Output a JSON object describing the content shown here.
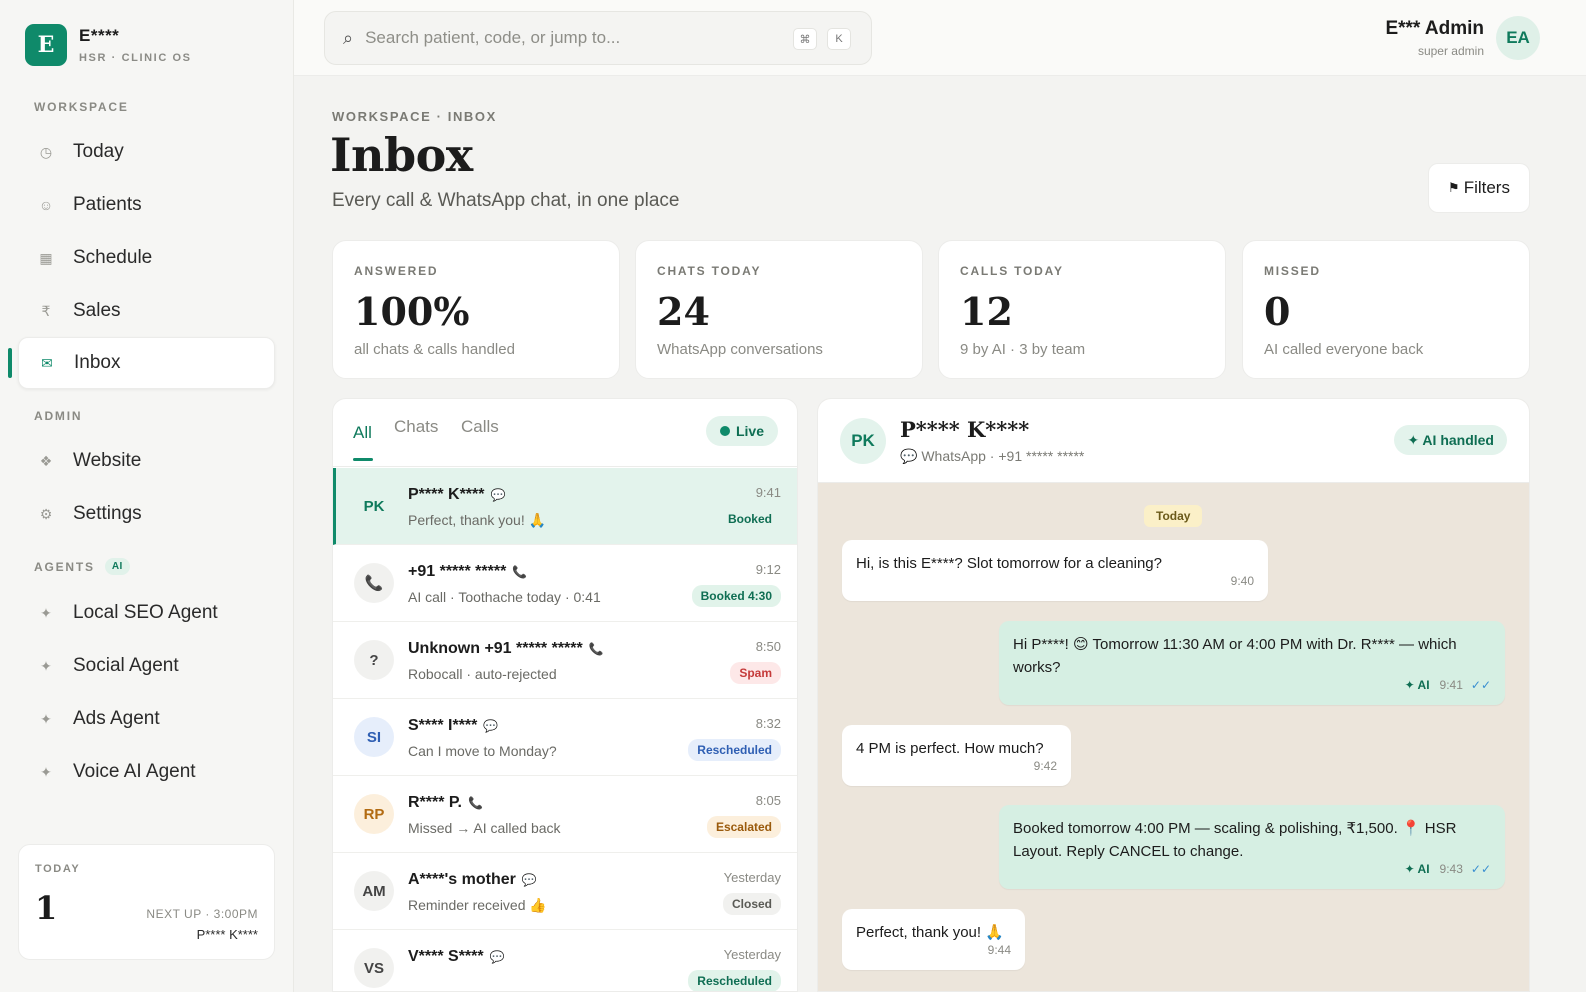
{
  "brand": {
    "logo_letter": "E",
    "name": "E****",
    "sub": "HSR · CLINIC OS"
  },
  "sidebar": {
    "workspace_label": "WORKSPACE",
    "workspace_items": [
      {
        "label": "Today",
        "icon": "clock-icon"
      },
      {
        "label": "Patients",
        "icon": "smile-icon"
      },
      {
        "label": "Schedule",
        "icon": "calendar-icon"
      },
      {
        "label": "Sales",
        "icon": "rupee-icon"
      },
      {
        "label": "Inbox",
        "icon": "mail-icon",
        "active": true
      }
    ],
    "admin_label": "ADMIN",
    "admin_items": [
      {
        "label": "Website",
        "icon": "diamond-icon"
      },
      {
        "label": "Settings",
        "icon": "gear-icon"
      }
    ],
    "agents_label": "AGENTS",
    "agents_chip": "AI",
    "agent_items": [
      {
        "label": "Local SEO Agent",
        "icon": "sparkle-icon"
      },
      {
        "label": "Social Agent",
        "icon": "sparkle-icon"
      },
      {
        "label": "Ads Agent",
        "icon": "sparkle-icon"
      },
      {
        "label": "Voice AI Agent",
        "icon": "sparkle-icon"
      }
    ],
    "today_card": {
      "label": "TODAY",
      "count": "1",
      "next_up": "NEXT UP · 3:00PM",
      "next_name": "P**** K****"
    }
  },
  "search": {
    "placeholder": "Search patient, code, or jump to...",
    "kbd1": "⌘",
    "kbd2": "K"
  },
  "user": {
    "name": "E*** Admin",
    "role": "super admin",
    "initials": "EA"
  },
  "header": {
    "breadcrumb": "WORKSPACE · INBOX",
    "title": "Inbox",
    "subtitle": "Every call & WhatsApp chat, in one place",
    "filters_label": "Filters"
  },
  "stats": [
    {
      "label": "ANSWERED",
      "value": "100%",
      "sub": "all chats & calls handled"
    },
    {
      "label": "CHATS TODAY",
      "value": "24",
      "sub": "WhatsApp conversations"
    },
    {
      "label": "CALLS TODAY",
      "value": "12",
      "sub": "9 by AI · 3 by team"
    },
    {
      "label": "MISSED",
      "value": "0",
      "sub": "AI called everyone back"
    }
  ],
  "list": {
    "tabs": [
      "All",
      "Chats",
      "Calls"
    ],
    "live_label": "Live",
    "rows": [
      {
        "initials": "PK",
        "name": "P**** K****",
        "kind": "chat",
        "preview": "Perfect, thank you! 🙏",
        "time": "9:41",
        "badge": "Booked",
        "badge_style": "plain-green",
        "selected": true
      },
      {
        "initials": "📞",
        "name": "+91 ***** *****",
        "kind": "call",
        "preview": "AI call · Toothache today · 0:41",
        "time": "9:12",
        "badge": "Booked 4:30",
        "badge_style": "green"
      },
      {
        "initials": "?",
        "name": "Unknown +91 ***** *****",
        "kind": "call",
        "preview": "Robocall · auto-rejected",
        "time": "8:50",
        "badge": "Spam",
        "badge_style": "red"
      },
      {
        "initials": "SI",
        "name": "S**** I****",
        "kind": "chat",
        "preview": "Can I move to Monday?",
        "time": "8:32",
        "badge": "Rescheduled",
        "badge_style": "blue"
      },
      {
        "initials": "RP",
        "name": "R**** P.",
        "kind": "call",
        "preview": "Missed → AI called back",
        "time": "8:05",
        "badge": "Escalated",
        "badge_style": "amber"
      },
      {
        "initials": "AM",
        "name": "A****'s mother",
        "kind": "chat",
        "preview": "Reminder received 👍",
        "time": "Yesterday",
        "badge": "Closed",
        "badge_style": "gray"
      },
      {
        "initials": "VS",
        "name": "V**** S****",
        "kind": "chat",
        "preview": "",
        "time": "Yesterday",
        "badge": "Rescheduled",
        "badge_style": "green"
      }
    ]
  },
  "chat": {
    "initials": "PK",
    "name": "P**** K****",
    "meta": "WhatsApp · +91 ***** *****",
    "status": "✦ AI handled",
    "day": "Today",
    "ai_tag": "✦ AI",
    "tick": "✓✓",
    "messages": [
      {
        "dir": "in",
        "text": "Hi, is this E****? Slot tomorrow for a cleaning?",
        "time": "9:40"
      },
      {
        "dir": "out",
        "text": "Hi P****! 😊 Tomorrow 11:30 AM or 4:00 PM with Dr. R**** — which works?",
        "time": "9:41",
        "ai": true
      },
      {
        "dir": "in",
        "text": "4 PM is perfect. How much?",
        "time": "9:42"
      },
      {
        "dir": "out",
        "text": "Booked tomorrow 4:00 PM — scaling & polishing, ₹1,500. 📍 HSR Layout. Reply CANCEL to change.",
        "time": "9:43",
        "ai": true
      },
      {
        "dir": "in",
        "text": "Perfect, thank you! 🙏",
        "time": "9:44"
      }
    ]
  },
  "colors": {
    "accent": "#0f8a6a",
    "chat_bg": "#ece5db",
    "out_bubble": "#d6efe3"
  }
}
